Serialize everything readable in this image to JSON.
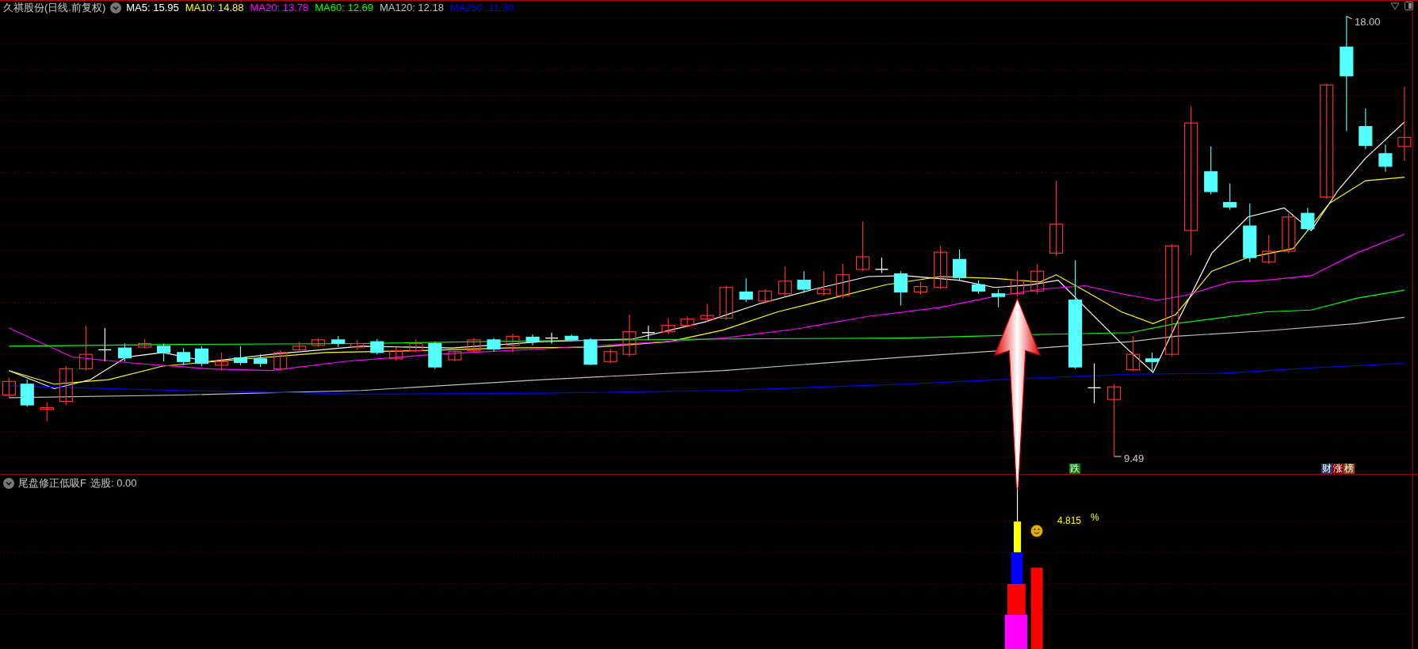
{
  "main_chart": {
    "title": "久祺股份(日线.前复权)",
    "moving_averages": [
      {
        "label": "MA5: 15.95",
        "color": "#ffffff"
      },
      {
        "label": "MA10: 14.88",
        "color": "#ffff00"
      },
      {
        "label": "MA20: 13.78",
        "color": "#ff00ff"
      },
      {
        "label": "MA60: 12.69",
        "color": "#00ff00"
      },
      {
        "label": "MA120: 12.18",
        "color": "#c0c0c0"
      },
      {
        "label": "MA250: 11.30",
        "color": "#0000ff"
      }
    ],
    "high_label": "18.00",
    "low_label": "9.49",
    "signals": [
      {
        "text": "跌",
        "color": "#008000"
      }
    ],
    "badges": [
      {
        "text": "财",
        "color": "#1f3f6f"
      },
      {
        "text": "涨",
        "color": "#8b0000"
      },
      {
        "text": "榜",
        "color": "#8b4513"
      }
    ]
  },
  "indicator": {
    "title": "尾盘修正低吸F",
    "reading": "选股: 0.00",
    "value_label": "4.815",
    "unit": "%"
  }
}
